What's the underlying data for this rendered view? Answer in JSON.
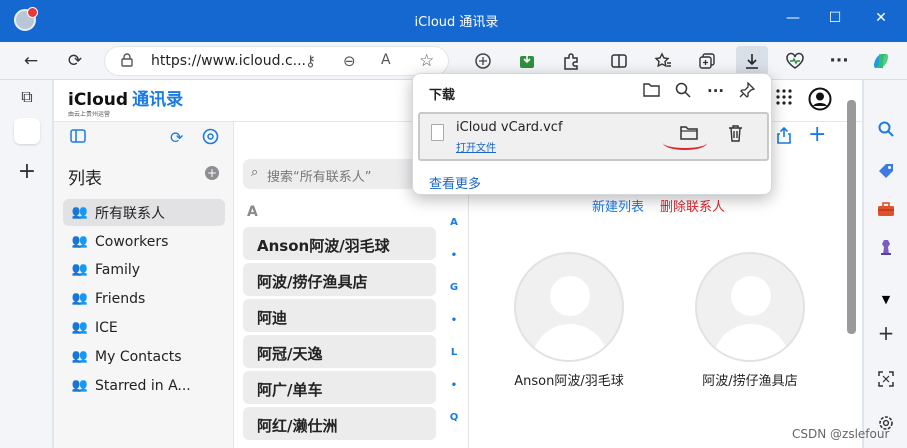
{
  "window": {
    "title": "iCloud 通讯录",
    "controls": {
      "minimize": "—",
      "maximize": "☐",
      "close": "✕"
    }
  },
  "browser": {
    "url": "https://www.icloud.c...",
    "icons": {
      "back": "←",
      "reload": "⟳",
      "lock": "🔒",
      "key": "⚷",
      "zoom": "⊖",
      "read": "A",
      "favorite": "☆",
      "more": "···"
    }
  },
  "left_rail": {
    "tabs_icon": "⧉",
    "apple_icon": "",
    "add_icon": "+"
  },
  "icloud": {
    "brand_name": "iCloud",
    "brand_app": "通讯录",
    "brand_sub": "由云上贵州运营",
    "sidebar": {
      "title": "列表",
      "items": [
        {
          "label": "所有联系人"
        },
        {
          "label": "Coworkers"
        },
        {
          "label": "Family"
        },
        {
          "label": "Friends"
        },
        {
          "label": "ICE"
        },
        {
          "label": "My Contacts"
        },
        {
          "label": "Starred in A..."
        }
      ]
    },
    "list": {
      "search_placeholder": "搜索“所有联系人”",
      "section_letter": "A",
      "contacts": [
        "Anson阿波/羽毛球",
        "阿波/捞仔渔具店",
        "阿迪",
        "阿冠/天逸",
        "阿广/单车",
        "阿红/濑仕洲"
      ],
      "index": [
        "A",
        "•",
        "G",
        "•",
        "L",
        "•",
        "Q"
      ]
    },
    "detail": {
      "new_list": "新建列表",
      "delete_contact": "删除联系人",
      "cards": [
        {
          "name": "Anson阿波/羽毛球"
        },
        {
          "name": "阿波/捞仔渔具店"
        }
      ]
    }
  },
  "downloads": {
    "title": "下载",
    "item": {
      "filename": "iCloud vCard.vcf",
      "open_label": "打开文件"
    },
    "see_more": "查看更多"
  },
  "watermark": "CSDN @zslefour",
  "colors": {
    "accent": "#1a7be6",
    "titlebar": "#1668d1",
    "danger": "#e0242c"
  }
}
